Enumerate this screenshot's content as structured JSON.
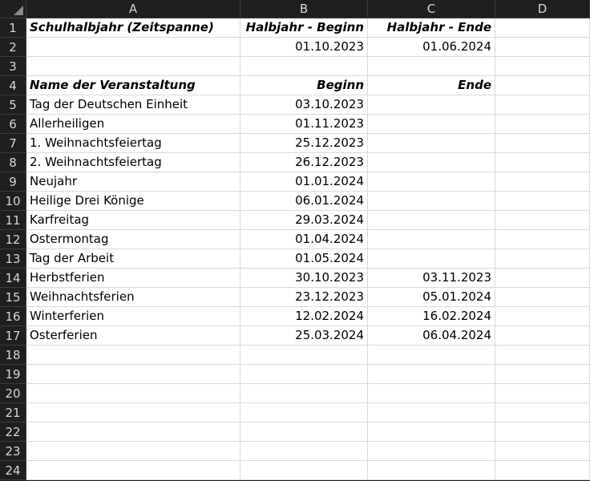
{
  "columns": [
    "A",
    "B",
    "C",
    "D"
  ],
  "rows": [
    {
      "n": "1",
      "a": "Schulhalbjahr (Zeitspanne)",
      "b": "Halbjahr - Beginn",
      "c": "Halbjahr - Ende",
      "d": "",
      "bold": true
    },
    {
      "n": "2",
      "a": "",
      "b": "01.10.2023",
      "c": "01.06.2024",
      "d": "",
      "bold": false
    },
    {
      "n": "3",
      "a": "",
      "b": "",
      "c": "",
      "d": "",
      "bold": false
    },
    {
      "n": "4",
      "a": "Name der Veranstaltung",
      "b": "Beginn",
      "c": "Ende",
      "d": "",
      "bold": true
    },
    {
      "n": "5",
      "a": "Tag der Deutschen Einheit",
      "b": "03.10.2023",
      "c": "",
      "d": "",
      "bold": false
    },
    {
      "n": "6",
      "a": "Allerheiligen",
      "b": "01.11.2023",
      "c": "",
      "d": "",
      "bold": false
    },
    {
      "n": "7",
      "a": "1. Weihnachtsfeiertag",
      "b": "25.12.2023",
      "c": "",
      "d": "",
      "bold": false
    },
    {
      "n": "8",
      "a": "2. Weihnachtsfeiertag",
      "b": "26.12.2023",
      "c": "",
      "d": "",
      "bold": false
    },
    {
      "n": "9",
      "a": "Neujahr",
      "b": "01.01.2024",
      "c": "",
      "d": "",
      "bold": false
    },
    {
      "n": "10",
      "a": "Heilige Drei Könige",
      "b": "06.01.2024",
      "c": "",
      "d": "",
      "bold": false
    },
    {
      "n": "11",
      "a": "Karfreitag",
      "b": "29.03.2024",
      "c": "",
      "d": "",
      "bold": false
    },
    {
      "n": "12",
      "a": "Ostermontag",
      "b": "01.04.2024",
      "c": "",
      "d": "",
      "bold": false
    },
    {
      "n": "13",
      "a": "Tag der Arbeit",
      "b": "01.05.2024",
      "c": "",
      "d": "",
      "bold": false
    },
    {
      "n": "14",
      "a": "Herbstferien",
      "b": "30.10.2023",
      "c": "03.11.2023",
      "d": "",
      "bold": false
    },
    {
      "n": "15",
      "a": "Weihnachtsferien",
      "b": "23.12.2023",
      "c": "05.01.2024",
      "d": "",
      "bold": false
    },
    {
      "n": "16",
      "a": "Winterferien",
      "b": "12.02.2024",
      "c": "16.02.2024",
      "d": "",
      "bold": false
    },
    {
      "n": "17",
      "a": "Osterferien",
      "b": "25.03.2024",
      "c": "06.04.2024",
      "d": "",
      "bold": false
    },
    {
      "n": "18",
      "a": "",
      "b": "",
      "c": "",
      "d": "",
      "bold": false
    },
    {
      "n": "19",
      "a": "",
      "b": "",
      "c": "",
      "d": "",
      "bold": false
    },
    {
      "n": "20",
      "a": "",
      "b": "",
      "c": "",
      "d": "",
      "bold": false
    },
    {
      "n": "21",
      "a": "",
      "b": "",
      "c": "",
      "d": "",
      "bold": false
    },
    {
      "n": "22",
      "a": "",
      "b": "",
      "c": "",
      "d": "",
      "bold": false
    },
    {
      "n": "23",
      "a": "",
      "b": "",
      "c": "",
      "d": "",
      "bold": false
    },
    {
      "n": "24",
      "a": "",
      "b": "",
      "c": "",
      "d": "",
      "bold": false
    }
  ]
}
